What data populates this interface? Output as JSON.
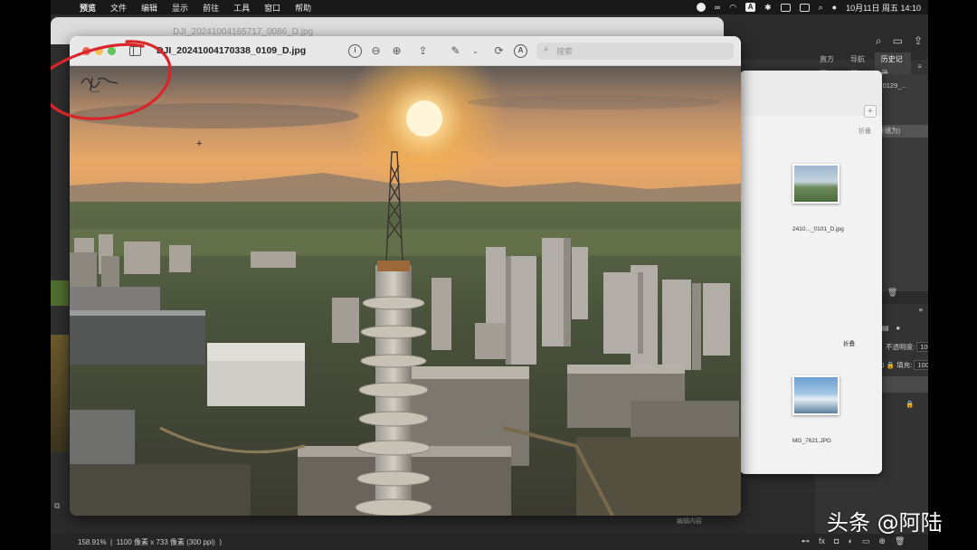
{
  "menubar": {
    "app_name": "预览",
    "items": [
      "文件",
      "编辑",
      "显示",
      "前往",
      "工具",
      "窗口",
      "帮助"
    ],
    "input_source": "A",
    "datetime": "10月11日 周五  14:10"
  },
  "back_window": {
    "title": "DJI_20241004165717_0086_D.jpg"
  },
  "preview_window": {
    "title": "DJI_20241004170338_0109_D.jpg",
    "search_placeholder": "搜索",
    "signature_mark": "ziyuzhe"
  },
  "photoshop": {
    "panel_tabs": [
      "直方图",
      "导航器",
      "历史记录"
    ],
    "active_tab": "历史记录",
    "history": {
      "snapshot_name": "20240802180019_0129_...",
      "rows": [
        "大小",
        "置入的智能对象 (存储为)"
      ]
    },
    "layers_tab": "路径",
    "opacity_label": "不透明度:",
    "opacity_value": "100%",
    "fill_label": "填充:",
    "fill_value": "100%",
    "layer_name": "名1的副本",
    "layer_name_2": "景",
    "edit_label": "编辑内容",
    "status_zoom": "158.91%",
    "status_info": "1100 像素 x 733 像素 (300 ppi)"
  },
  "file_window": {
    "fold_label": "折叠",
    "fold_label_2": "折叠",
    "files": [
      "2410..._0101_D.jpg",
      "MG_7621.JPG"
    ]
  },
  "watermark": "头条 @阿陆",
  "colors": {
    "annotation": "#d9262b",
    "menubar": "#191919",
    "ps_background": "#2b2b2b",
    "sky_top": "#5f5a57",
    "sky_glow": "#f4b24f"
  }
}
